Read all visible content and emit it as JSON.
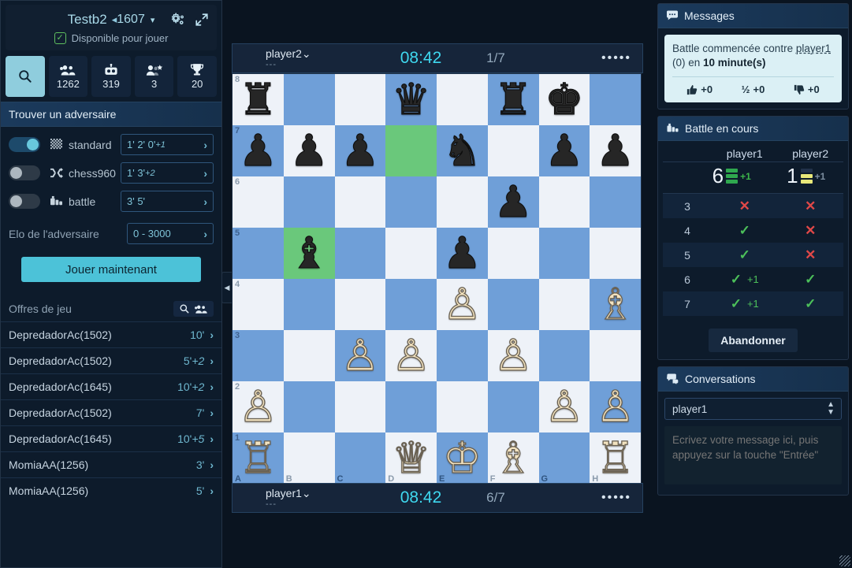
{
  "sidebar": {
    "user": {
      "name": "Testb2",
      "rating": "1607",
      "rating_icon": "bolt-icon",
      "caret": "▾"
    },
    "available": {
      "label": "Disponible pour jouer",
      "checked": true,
      "check_glyph": "✓"
    },
    "header_icons": [
      {
        "name": "settings-gears-icon"
      },
      {
        "name": "fullscreen-expand-icon"
      }
    ],
    "stats": [
      {
        "icon": "search-icon",
        "value": "",
        "active": true
      },
      {
        "icon": "people-group-icon",
        "value": "1262",
        "active": false
      },
      {
        "icon": "robot-icon",
        "value": "319",
        "active": false
      },
      {
        "icon": "user-star-icon",
        "value": "3",
        "active": false
      },
      {
        "icon": "trophy-icon",
        "value": "20",
        "active": false
      }
    ],
    "find": {
      "title": "Trouver un adversaire",
      "variants": [
        {
          "label": "standard",
          "icon": "checkerboard-icon",
          "enabled": true,
          "times": "1'  2'  0'",
          "inc": "+1"
        },
        {
          "label": "chess960",
          "icon": "shuffle-icon",
          "enabled": false,
          "times": "1'  3'",
          "inc": "+2"
        },
        {
          "label": "battle",
          "icon": "battle-icon",
          "enabled": false,
          "times": "3'  5'",
          "inc": ""
        }
      ],
      "elo_label": "Elo de l'adversaire",
      "elo_value": "0 - 3000",
      "play_button": "Jouer maintenant",
      "chevron": "›"
    },
    "offers": {
      "title": "Offres de jeu",
      "action_icons": [
        {
          "name": "search-icon"
        },
        {
          "name": "people-group-icon"
        }
      ],
      "rows": [
        {
          "name": "DepredadorAc(1502)",
          "time": "10'",
          "inc": ""
        },
        {
          "name": "DepredadorAc(1502)",
          "time": "5'",
          "inc": "+2"
        },
        {
          "name": "DepredadorAc(1645)",
          "time": "10'",
          "inc": "+2"
        },
        {
          "name": "DepredadorAc(1502)",
          "time": "7'",
          "inc": ""
        },
        {
          "name": "DepredadorAc(1645)",
          "time": "10'",
          "inc": "+5"
        },
        {
          "name": "MomiaAA(1256)",
          "time": "3'",
          "inc": ""
        },
        {
          "name": "MomiaAA(1256)",
          "time": "5'",
          "inc": ""
        }
      ]
    }
  },
  "board": {
    "collapse_glyph": "◀",
    "top_player": {
      "name": "player2",
      "caret": "⌄",
      "dashes": "---",
      "clock": "08:42",
      "moves": "1/7",
      "menu": "•••••"
    },
    "bottom_player": {
      "name": "player1",
      "caret": "⌄",
      "dashes": "---",
      "clock": "08:42",
      "moves": "6/7",
      "menu": "•••••"
    },
    "files": [
      "A",
      "B",
      "C",
      "D",
      "E",
      "F",
      "G",
      "H"
    ],
    "ranks": [
      "8",
      "7",
      "6",
      "5",
      "4",
      "3",
      "2",
      "1"
    ],
    "highlighted": [
      "d7",
      "b5"
    ],
    "colors": {
      "light": "#eef2f8",
      "dark": "#6f9fd8",
      "highlight": "#6ac87b"
    },
    "position": [
      [
        "br",
        "",
        "",
        "bq",
        "",
        "br",
        "bk",
        ""
      ],
      [
        "bp",
        "bp",
        "bp",
        "",
        "bn",
        "",
        "bp",
        "bp"
      ],
      [
        "",
        "",
        "",
        "",
        "",
        "bp",
        "",
        ""
      ],
      [
        "",
        "bb",
        "",
        "",
        "bp",
        "",
        "",
        ""
      ],
      [
        "",
        "",
        "",
        "",
        "wp",
        "",
        "",
        "wb"
      ],
      [
        "",
        "",
        "wp",
        "wp",
        "",
        "wp",
        "",
        ""
      ],
      [
        "wp",
        "",
        "",
        "",
        "",
        "",
        "wp",
        "wp"
      ],
      [
        "wr",
        "",
        "",
        "wq",
        "wk",
        "wb",
        "",
        "wr"
      ]
    ]
  },
  "right": {
    "messages": {
      "title": "Messages",
      "icon": "chat-bubble-icon",
      "text_part1": "Battle commencée contre ",
      "user": "player1",
      "text_part2": " (0) en ",
      "bold": "10 minute(s)",
      "actions": [
        {
          "icon": "thumbs-up-icon",
          "label": "+0"
        },
        {
          "icon": "half-icon",
          "label": "+0",
          "glyph": "½"
        },
        {
          "icon": "thumbs-down-icon",
          "label": "+0"
        }
      ]
    },
    "battle": {
      "title": "Battle en cours",
      "icon": "battle-icon",
      "players": [
        "player1",
        "player2"
      ],
      "scores": [
        {
          "value": "6",
          "bars": [
            "g",
            "g",
            "g"
          ],
          "plus": "+1",
          "plus_color": "green"
        },
        {
          "value": "1",
          "bars": [
            "dk",
            "y",
            "y"
          ],
          "plus": "+1",
          "plus_color": "grey"
        }
      ],
      "rows": [
        {
          "index": "3",
          "p1": "x",
          "p1_bonus": "",
          "p2": "x"
        },
        {
          "index": "4",
          "p1": "v",
          "p1_bonus": "",
          "p2": "x"
        },
        {
          "index": "5",
          "p1": "v",
          "p1_bonus": "",
          "p2": "x"
        },
        {
          "index": "6",
          "p1": "v",
          "p1_bonus": "+1",
          "p2": "v"
        },
        {
          "index": "7",
          "p1": "v",
          "p1_bonus": "+1",
          "p2": "v"
        }
      ],
      "abandon_label": "Abandonner",
      "mark_x": "✕",
      "mark_v": "✓"
    },
    "conversations": {
      "title": "Conversations",
      "icon": "chats-icon",
      "selected": "player1",
      "placeholder": "Ecrivez votre message ici, puis appuyez sur la touche \"Entrée\""
    }
  }
}
